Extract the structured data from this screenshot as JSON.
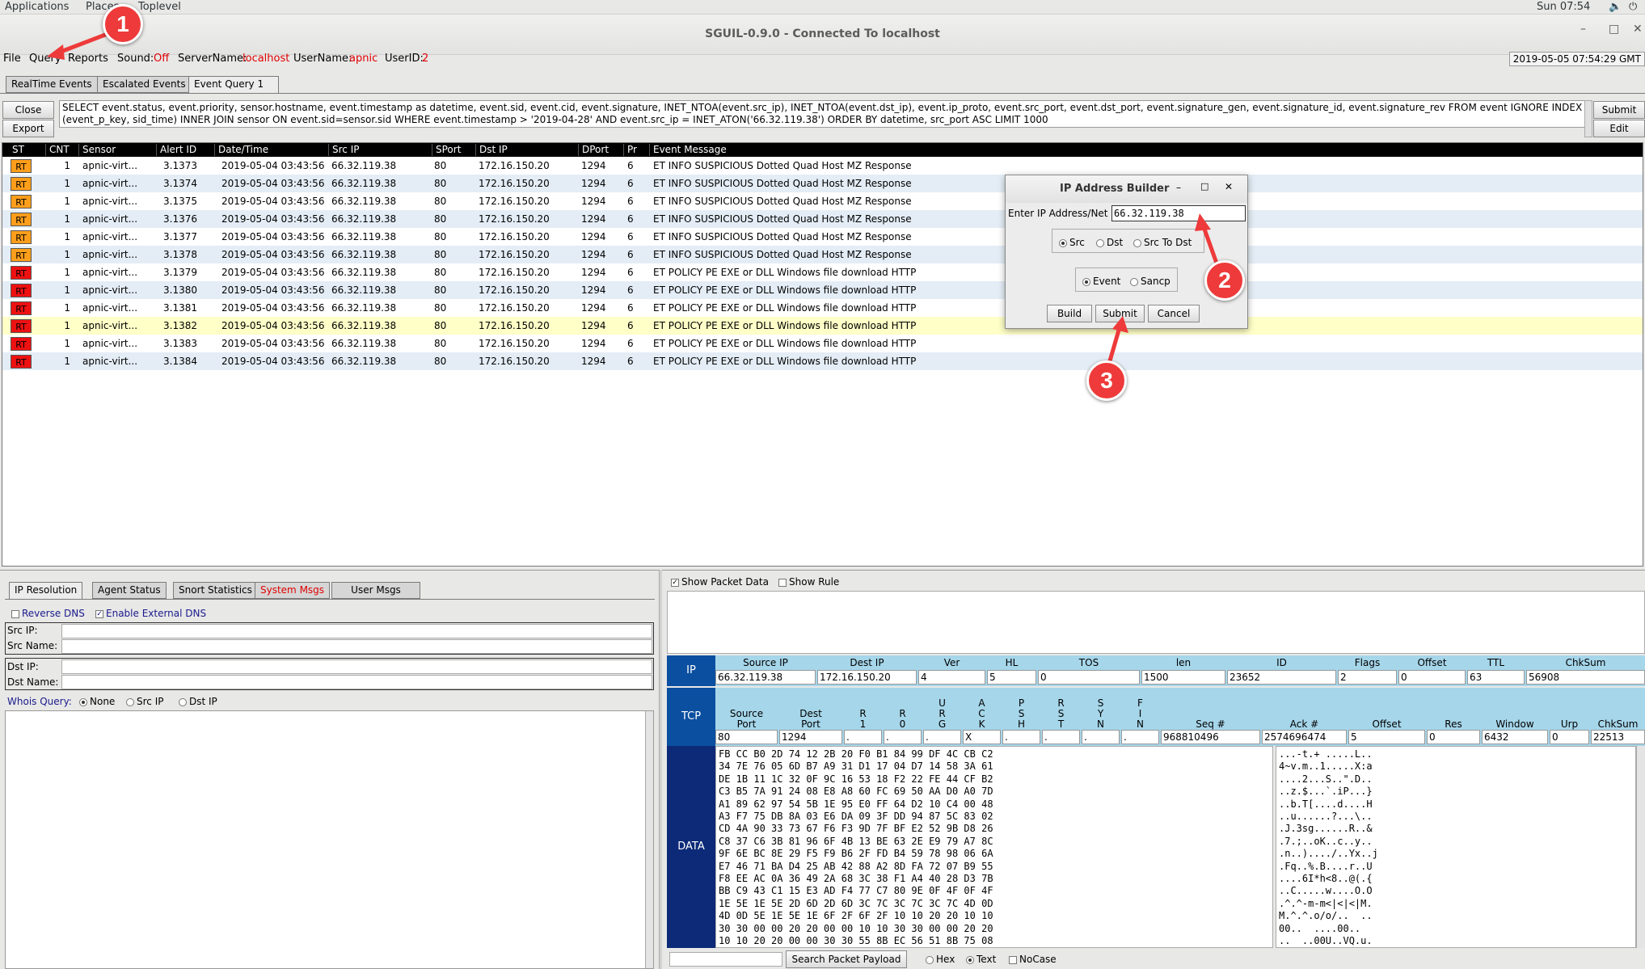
{
  "top_panel": {
    "applications": "Applications",
    "places": "Places",
    "toplevel": "Toplevel",
    "clock": "Sun 07:54"
  },
  "window": {
    "title": "SGUIL-0.9.0 - Connected To localhost",
    "datetime": "2019-05-05 07:54:29 GMT"
  },
  "menu": {
    "file": "File",
    "query": "Query",
    "reports": "Reports",
    "sound_label": "Sound:",
    "sound_value": "Off",
    "server_label": "ServerName:",
    "server_value": "localhost",
    "user_label": "UserName:",
    "user_value": "apnic",
    "userid_label": "UserID:",
    "userid_value": "2"
  },
  "tabs": [
    "RealTime Events",
    "Escalated Events",
    "Event Query 1"
  ],
  "buttons": {
    "close": "Close",
    "export": "Export",
    "submit": "Submit",
    "edit": "Edit"
  },
  "query_text": "SELECT event.status, event.priority, sensor.hostname,  event.timestamp as datetime, event.sid, event.cid, event.signature, INET_NTOA(event.src_ip), INET_NTOA(event.dst_ip), event.ip_proto, event.src_port, event.dst_port, event.signature_gen, event.signature_id,  event.signature_rev FROM event IGNORE INDEX (event_p_key, sid_time) INNER JOIN sensor ON event.sid=sensor.sid WHERE event.timestamp > '2019-04-28' AND event.src_ip = INET_ATON('66.32.119.38') ORDER BY datetime, src_port ASC LIMIT 1000",
  "columns": [
    "ST",
    "CNT",
    "Sensor",
    "Alert ID",
    "Date/Time",
    "Src IP",
    "SPort",
    "Dst IP",
    "DPort",
    "Pr",
    "Event Message"
  ],
  "events": [
    {
      "st": "RT",
      "color": "#ff9e1b",
      "cnt": "1",
      "sensor": "apnic-virt...",
      "alert": "3.1373",
      "dt": "2019-05-04 03:43:56",
      "src": "66.32.119.38",
      "sport": "80",
      "dst": "172.16.150.20",
      "dport": "1294",
      "pr": "6",
      "msg": "ET INFO SUSPICIOUS Dotted Quad Host MZ Response"
    },
    {
      "st": "RT",
      "color": "#ff9e1b",
      "cnt": "1",
      "sensor": "apnic-virt...",
      "alert": "3.1374",
      "dt": "2019-05-04 03:43:56",
      "src": "66.32.119.38",
      "sport": "80",
      "dst": "172.16.150.20",
      "dport": "1294",
      "pr": "6",
      "msg": "ET INFO SUSPICIOUS Dotted Quad Host MZ Response"
    },
    {
      "st": "RT",
      "color": "#ff9e1b",
      "cnt": "1",
      "sensor": "apnic-virt...",
      "alert": "3.1375",
      "dt": "2019-05-04 03:43:56",
      "src": "66.32.119.38",
      "sport": "80",
      "dst": "172.16.150.20",
      "dport": "1294",
      "pr": "6",
      "msg": "ET INFO SUSPICIOUS Dotted Quad Host MZ Response"
    },
    {
      "st": "RT",
      "color": "#ff9e1b",
      "cnt": "1",
      "sensor": "apnic-virt...",
      "alert": "3.1376",
      "dt": "2019-05-04 03:43:56",
      "src": "66.32.119.38",
      "sport": "80",
      "dst": "172.16.150.20",
      "dport": "1294",
      "pr": "6",
      "msg": "ET INFO SUSPICIOUS Dotted Quad Host MZ Response"
    },
    {
      "st": "RT",
      "color": "#ff9e1b",
      "cnt": "1",
      "sensor": "apnic-virt...",
      "alert": "3.1377",
      "dt": "2019-05-04 03:43:56",
      "src": "66.32.119.38",
      "sport": "80",
      "dst": "172.16.150.20",
      "dport": "1294",
      "pr": "6",
      "msg": "ET INFO SUSPICIOUS Dotted Quad Host MZ Response"
    },
    {
      "st": "RT",
      "color": "#ff9e1b",
      "cnt": "1",
      "sensor": "apnic-virt...",
      "alert": "3.1378",
      "dt": "2019-05-04 03:43:56",
      "src": "66.32.119.38",
      "sport": "80",
      "dst": "172.16.150.20",
      "dport": "1294",
      "pr": "6",
      "msg": "ET INFO SUSPICIOUS Dotted Quad Host MZ Response"
    },
    {
      "st": "RT",
      "color": "#ee1111",
      "cnt": "1",
      "sensor": "apnic-virt...",
      "alert": "3.1379",
      "dt": "2019-05-04 03:43:56",
      "src": "66.32.119.38",
      "sport": "80",
      "dst": "172.16.150.20",
      "dport": "1294",
      "pr": "6",
      "msg": "ET POLICY PE EXE or DLL Windows file download HTTP"
    },
    {
      "st": "RT",
      "color": "#ee1111",
      "cnt": "1",
      "sensor": "apnic-virt...",
      "alert": "3.1380",
      "dt": "2019-05-04 03:43:56",
      "src": "66.32.119.38",
      "sport": "80",
      "dst": "172.16.150.20",
      "dport": "1294",
      "pr": "6",
      "msg": "ET POLICY PE EXE or DLL Windows file download HTTP"
    },
    {
      "st": "RT",
      "color": "#ee1111",
      "cnt": "1",
      "sensor": "apnic-virt...",
      "alert": "3.1381",
      "dt": "2019-05-04 03:43:56",
      "src": "66.32.119.38",
      "sport": "80",
      "dst": "172.16.150.20",
      "dport": "1294",
      "pr": "6",
      "msg": "ET POLICY PE EXE or DLL Windows file download HTTP"
    },
    {
      "st": "RT",
      "color": "#ee1111",
      "cnt": "1",
      "sensor": "apnic-virt...",
      "alert": "3.1382",
      "dt": "2019-05-04 03:43:56",
      "src": "66.32.119.38",
      "sport": "80",
      "dst": "172.16.150.20",
      "dport": "1294",
      "pr": "6",
      "msg": "ET POLICY PE EXE or DLL Windows file download HTTP"
    },
    {
      "st": "RT",
      "color": "#ee1111",
      "cnt": "1",
      "sensor": "apnic-virt...",
      "alert": "3.1383",
      "dt": "2019-05-04 03:43:56",
      "src": "66.32.119.38",
      "sport": "80",
      "dst": "172.16.150.20",
      "dport": "1294",
      "pr": "6",
      "msg": "ET POLICY PE EXE or DLL Windows file download HTTP"
    },
    {
      "st": "RT",
      "color": "#ee1111",
      "cnt": "1",
      "sensor": "apnic-virt...",
      "alert": "3.1384",
      "dt": "2019-05-04 03:43:56",
      "src": "66.32.119.38",
      "sport": "80",
      "dst": "172.16.150.20",
      "dport": "1294",
      "pr": "6",
      "msg": "ET POLICY PE EXE or DLL Windows file download HTTP"
    }
  ],
  "dialog": {
    "title": "IP Address Builder",
    "label": "Enter IP Address/Net",
    "value": "66.32.119.38",
    "dir_options": [
      "Src",
      "Dst",
      "Src To Dst"
    ],
    "type_options": [
      "Event",
      "Sancp"
    ],
    "build": "Build",
    "submit": "Submit",
    "cancel": "Cancel"
  },
  "lower_tabs": [
    "IP Resolution",
    "Agent Status",
    "Snort Statistics",
    "System Msgs",
    "User Msgs"
  ],
  "ipres": {
    "reverse_dns": "Reverse DNS",
    "external_dns": "Enable External DNS",
    "src_ip": "Src IP:",
    "src_name": "Src Name:",
    "dst_ip": "Dst IP:",
    "dst_name": "Dst Name:",
    "whois_label": "Whois Query:",
    "whois_opts": [
      "None",
      "Src IP",
      "Dst IP"
    ]
  },
  "packet": {
    "show_packet_data": "Show Packet Data",
    "show_rule": "Show Rule",
    "ip_label": "IP",
    "ip_headers": [
      "Source IP",
      "Dest IP",
      "Ver",
      "HL",
      "TOS",
      "len",
      "ID",
      "Flags",
      "Offset",
      "TTL",
      "ChkSum"
    ],
    "ip_values": [
      "66.32.119.38",
      "172.16.150.20",
      "4",
      "5",
      "0",
      "1500",
      "23652",
      "2",
      "0",
      "63",
      "56908"
    ],
    "tcp_label": "TCP",
    "tcp_headers": [
      "Source\nPort",
      "Dest\nPort",
      "R\n1",
      "R\n0",
      "U\nR\nG",
      "A\nC\nK",
      "P\nS\nH",
      "R\nS\nT",
      "S\nY\nN",
      "F\nI\nN",
      "Seq #",
      "Ack #",
      "Offset",
      "Res",
      "Window",
      "Urp",
      "ChkSum"
    ],
    "tcp_values": [
      "80",
      "1294",
      ".",
      ".",
      ".",
      "X",
      ".",
      ".",
      ".",
      ".",
      "968810496",
      "2574696474",
      "5",
      "0",
      "6432",
      "0",
      "22513"
    ],
    "data_label": "DATA",
    "hex": [
      "FB CC B0 2D 74 12 2B 20 F0 B1 84 99 DF 4C CB C2",
      "34 7E 76 05 6D B7 A9 31 D1 17 04 D7 14 58 3A 61",
      "DE 1B 11 1C 32 0F 9C 16 53 18 F2 22 FE 44 CF B2",
      "C3 B5 7A 91 24 08 E8 A8 60 FC 69 50 AA D0 A0 7D",
      "A1 89 62 97 54 5B 1E 95 E0 FF 64 D2 10 C4 00 48",
      "A3 F7 75 DB 8A 03 E6 DA 09 3F DD 94 87 5C 83 02",
      "CD 4A 90 33 73 67 F6 F3 9D 7F BF E2 52 9B D8 26",
      "C8 37 C6 3B 81 96 6F 4B 13 BE 63 2E E9 79 A7 8C",
      "9F 6E BC 8E 29 F5 F9 B6 2F FD B4 59 78 98 06 6A",
      "E7 46 71 BA D4 25 AB 42 88 A2 8D FA 72 07 B9 55",
      "F8 EE AC 0A 36 49 2A 68 3C 38 F1 A4 40 28 D3 7B",
      "BB C9 43 C1 15 E3 AD F4 77 C7 80 9E 0F 4F 0F 4F",
      "1E 5E 1E 5E 2D 6D 2D 6D 3C 7C 3C 7C 3C 7C 4D 0D",
      "4D 0D 5E 1E 5E 1E 6F 2F 6F 2F 10 10 20 20 10 10",
      "30 30 00 00 20 20 00 00 10 10 30 30 00 00 20 20",
      "10 10 20 20 00 00 30 30 55 8B EC 56 51 8B 75 08"
    ],
    "ascii": [
      "...-t.+ .....L..",
      "4~v.m..1.....X:a",
      "....2...S..\".D..",
      "..z.$...`.iP...}",
      "..b.T[....d....H",
      "..u......?...\\..",
      ".J.3sg......R..&",
      ".7.;..oK..c..y..",
      ".n..)..../..Yx..j",
      ".Fq..%.B....r..U",
      "....6I*h<8..@(.{",
      "..C.....w....O.O",
      ".^.^-m-m<|<|<|M.",
      "M.^.^.o/o/..  ..",
      "00..  ....00..",
      "..  ..00U..VQ.u."
    ],
    "search_label": "Search Packet Payload",
    "search_opts": [
      "Hex",
      "Text",
      "NoCase"
    ]
  },
  "annotations": [
    "1",
    "2",
    "3"
  ],
  "colors": {
    "rt_orange": "#ff9e1b",
    "rt_red": "#ee1111",
    "highlight_row": "#ffffc8",
    "alt_row": "#e4edf6",
    "badge": "#ee3a3a"
  }
}
